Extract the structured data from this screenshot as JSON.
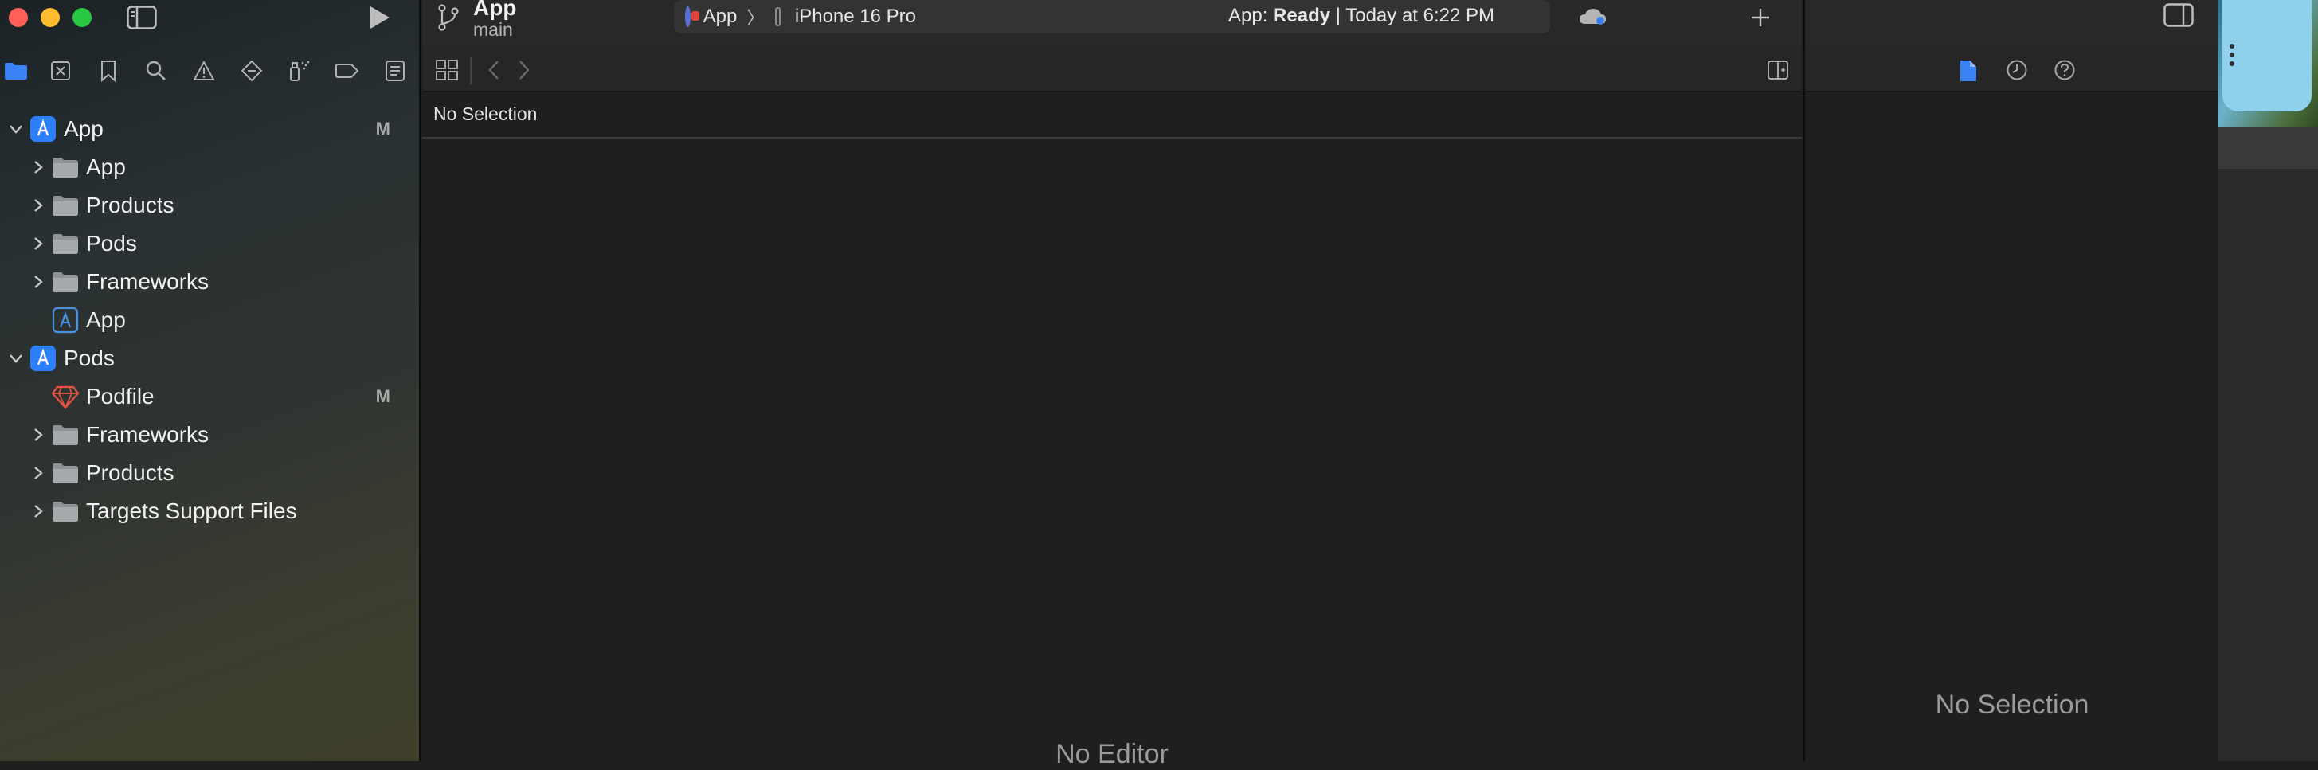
{
  "window": {
    "traffic_lights": {
      "close": "#ff5f57",
      "minimize": "#febc2e",
      "zoom": "#28c840"
    },
    "toolbar": {
      "project_name": "App",
      "branch": "main",
      "scheme": "App",
      "scheme_separator": "〉",
      "destination": "iPhone 16 Pro",
      "status_prefix": "App: ",
      "status_state": "Ready",
      "status_sep": " | ",
      "status_time": "Today at 6:22 PM"
    }
  },
  "sidebar": {
    "nav_tabs": [
      "folder-icon",
      "source-control-icon",
      "bookmark-icon",
      "find-icon",
      "issue-warning-icon",
      "test-diamond-icon",
      "debug-spray-icon",
      "breakpoint-icon",
      "report-icon"
    ],
    "accent": "#3b82f6",
    "tree": [
      {
        "label": "App",
        "type": "project",
        "expanded": true,
        "badge": "M"
      },
      {
        "label": "App",
        "type": "folder"
      },
      {
        "label": "Products",
        "type": "folder"
      },
      {
        "label": "Pods",
        "type": "folder"
      },
      {
        "label": "Frameworks",
        "type": "folder"
      },
      {
        "label": "App",
        "type": "app-target"
      },
      {
        "label": "Pods",
        "type": "project",
        "expanded": true
      },
      {
        "label": "Podfile",
        "type": "podfile",
        "badge": "M"
      },
      {
        "label": "Frameworks",
        "type": "folder"
      },
      {
        "label": "Products",
        "type": "folder"
      },
      {
        "label": "Targets Support Files",
        "type": "folder"
      }
    ]
  },
  "editor": {
    "selection_label": "No Selection",
    "placeholder": "No Editor"
  },
  "inspector": {
    "tabs": [
      "file-inspector-icon",
      "history-icon",
      "help-icon"
    ],
    "placeholder": "No Selection"
  }
}
